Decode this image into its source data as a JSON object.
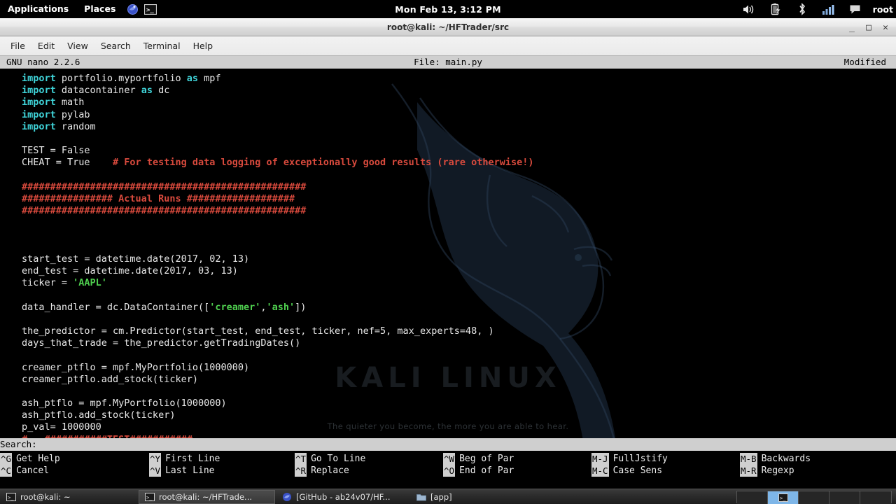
{
  "top_panel": {
    "applications": "Applications",
    "places": "Places",
    "browser_icon": "firefox-icon",
    "terminal_icon": "terminal-icon",
    "clock": "Mon Feb 13,  3:12 PM",
    "tray": {
      "volume_icon": "volume-icon",
      "battery_icon": "battery-charging-icon",
      "bluetooth_icon": "bluetooth-icon",
      "network_icon": "network-signal-icon",
      "chat_icon": "chat-icon",
      "user": "root"
    }
  },
  "window": {
    "title": "root@kali: ~/HFTrader/src",
    "minimize_label": "_",
    "maximize_label": "□",
    "close_label": "✕",
    "menubar": [
      "File",
      "Edit",
      "View",
      "Search",
      "Terminal",
      "Help"
    ]
  },
  "nano": {
    "version": "GNU nano 2.2.6",
    "file": "File: main.py",
    "modified": "Modified",
    "search_prompt": "Search:",
    "search_value": "",
    "lines": [
      [
        {
          "t": "import",
          "c": "kw"
        },
        {
          "t": " portfolio.myportfolio ",
          "c": "pl"
        },
        {
          "t": "as",
          "c": "kw"
        },
        {
          "t": " mpf",
          "c": "pl"
        }
      ],
      [
        {
          "t": "import",
          "c": "kw"
        },
        {
          "t": " datacontainer ",
          "c": "pl"
        },
        {
          "t": "as",
          "c": "kw"
        },
        {
          "t": " dc",
          "c": "pl"
        }
      ],
      [
        {
          "t": "import",
          "c": "kw"
        },
        {
          "t": " math",
          "c": "pl"
        }
      ],
      [
        {
          "t": "import",
          "c": "kw"
        },
        {
          "t": " pylab",
          "c": "pl"
        }
      ],
      [
        {
          "t": "import",
          "c": "kw"
        },
        {
          "t": " random",
          "c": "pl"
        }
      ],
      [],
      [
        {
          "t": "TEST = False",
          "c": "pl"
        }
      ],
      [
        {
          "t": "CHEAT = True    ",
          "c": "pl"
        },
        {
          "t": "# For testing data logging of exceptionally good results (rare otherwise!)",
          "c": "cmt"
        }
      ],
      [],
      [
        {
          "t": "##################################################",
          "c": "cmt"
        }
      ],
      [
        {
          "t": "################ Actual Runs ###################",
          "c": "cmt"
        }
      ],
      [
        {
          "t": "##################################################",
          "c": "cmt"
        }
      ],
      [],
      [],
      [],
      [
        {
          "t": "start_test = datetime.date(2017, 02, 13)",
          "c": "pl"
        }
      ],
      [
        {
          "t": "end_test = datetime.date(2017, 03, 13)",
          "c": "pl"
        }
      ],
      [
        {
          "t": "ticker = ",
          "c": "pl"
        },
        {
          "t": "'AAPL'",
          "c": "str"
        }
      ],
      [],
      [
        {
          "t": "data_handler = dc.DataContainer([",
          "c": "pl"
        },
        {
          "t": "'creamer'",
          "c": "str"
        },
        {
          "t": ",",
          "c": "pl"
        },
        {
          "t": "'ash'",
          "c": "str"
        },
        {
          "t": "])",
          "c": "pl"
        }
      ],
      [],
      [
        {
          "t": "the_predictor = cm.Predictor(start_test, end_test, ticker, nef=5, max_experts=48, )",
          "c": "pl"
        }
      ],
      [
        {
          "t": "days_that_trade = the_predictor.getTradingDates()",
          "c": "pl"
        }
      ],
      [],
      [
        {
          "t": "creamer_ptflo = mpf.MyPortfolio(1000000)",
          "c": "pl"
        }
      ],
      [
        {
          "t": "creamer_ptflo.add_stock(ticker)",
          "c": "pl"
        }
      ],
      [],
      [
        {
          "t": "ash_ptflo = mpf.MyPortfolio(1000000)",
          "c": "pl"
        }
      ],
      [
        {
          "t": "ash_ptflo.add_stock(ticker)",
          "c": "pl"
        }
      ],
      [
        {
          "t": "p_val= 1000000",
          "c": "pl"
        }
      ],
      [
        {
          "t": "#   ###########TEST###########",
          "c": "cmt"
        }
      ]
    ],
    "shortcuts": [
      [
        {
          "key": "^G",
          "label": "Get Help"
        },
        {
          "key": "^Y",
          "label": "First Line"
        },
        {
          "key": "^T",
          "label": "Go To Line"
        },
        {
          "key": "^W",
          "label": "Beg of Par"
        },
        {
          "key": "M-J",
          "label": "FullJstify"
        },
        {
          "key": "M-B",
          "label": "Backwards"
        }
      ],
      [
        {
          "key": "^C",
          "label": "Cancel"
        },
        {
          "key": "^V",
          "label": "Last Line"
        },
        {
          "key": "^R",
          "label": "Replace"
        },
        {
          "key": "^O",
          "label": "End of Par"
        },
        {
          "key": "M-C",
          "label": "Case Sens"
        },
        {
          "key": "M-R",
          "label": "Regexp"
        }
      ]
    ]
  },
  "watermark": {
    "title": "KALI LINUX",
    "tagline": "The quieter you become, the more you are able to hear."
  },
  "taskbar": {
    "items": [
      {
        "icon": "terminal-icon",
        "label": "root@kali: ~",
        "active": false
      },
      {
        "icon": "terminal-icon",
        "label": "root@kali: ~/HFTrade...",
        "active": true
      },
      {
        "icon": "firefox-icon",
        "label": "[GitHub - ab24v07/HF...",
        "active": false
      },
      {
        "icon": "folder-icon",
        "label": "[app]",
        "active": false
      }
    ],
    "workspaces": [
      {
        "active": false
      },
      {
        "active": true
      },
      {
        "active": false
      },
      {
        "active": false
      },
      {
        "active": false
      }
    ]
  },
  "colors": {
    "keyword": "#3fd3d8",
    "string": "#4fd04f",
    "comment": "#d94a3d",
    "background": "#000000",
    "status_bar": "#cfcfcf"
  }
}
